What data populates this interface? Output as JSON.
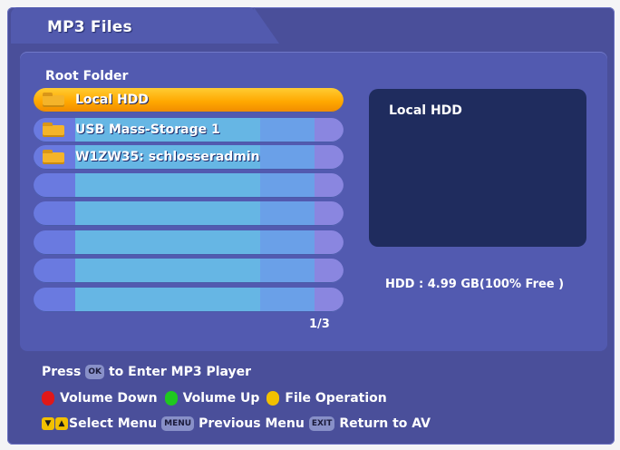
{
  "header": {
    "title": "MP3 Files"
  },
  "browser": {
    "root_label": "Root Folder",
    "items": [
      {
        "label": "Local HDD"
      },
      {
        "label": "USB Mass-Storage 1"
      },
      {
        "label": "W1ZW35: schlosseradmin"
      }
    ],
    "page_indicator": "1/3"
  },
  "info_panel": {
    "title": "Local HDD",
    "hdd_status": "HDD : 4.99 GB(100% Free )"
  },
  "help": {
    "line1": {
      "press": "Press",
      "ok_key": "OK",
      "text": "to Enter MP3 Player"
    },
    "line2": {
      "red_label": "Volume Down",
      "green_label": "Volume Up",
      "yellow_label": "File Operation",
      "colors": {
        "red": "#e01818",
        "green": "#1fc81f",
        "yellow": "#f2c000"
      }
    },
    "line3": {
      "select_label": "Select Menu",
      "menu_key": "MENU",
      "menu_label": "Previous Menu",
      "exit_key": "EXIT",
      "exit_label": "Return to AV"
    }
  },
  "colors": {
    "selected": "#ffb000",
    "panel": "#525ab0",
    "info_box": "#1f2c5e"
  }
}
